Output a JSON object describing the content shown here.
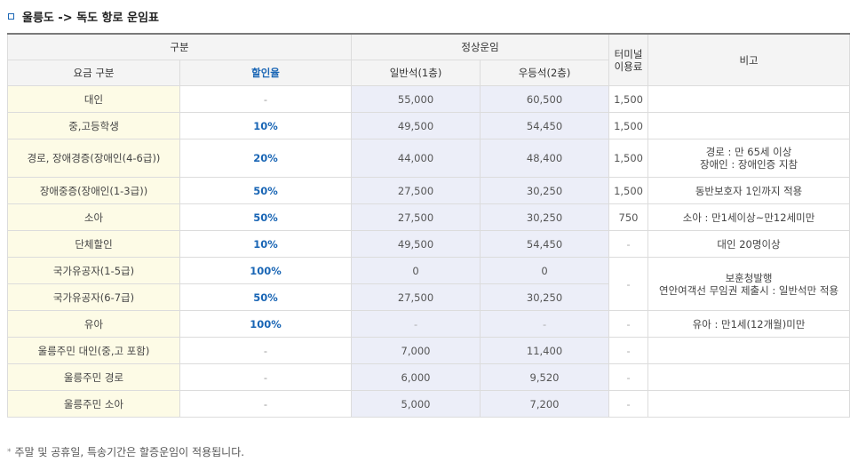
{
  "title": "울릉도 -> 독도 항로 운임표",
  "headers": {
    "category_group": "구분",
    "regular_fare": "정상운임",
    "terminal_fee": "터미널\n이용료",
    "remarks": "비고",
    "fare_type": "요금 구분",
    "discount_rate": "할인율",
    "general_seat": "일반석(1층)",
    "premium_seat": "우등석(2층)"
  },
  "rows": [
    {
      "category": "대인",
      "rate": "-",
      "general": "55,000",
      "premium": "60,500",
      "terminal": "1,500",
      "remark": ""
    },
    {
      "category": "중,고등학생",
      "rate": "10%",
      "general": "49,500",
      "premium": "54,450",
      "terminal": "1,500",
      "remark": ""
    },
    {
      "category": "경로, 장애경증(장애인(4-6급))",
      "rate": "20%",
      "general": "44,000",
      "premium": "48,400",
      "terminal": "1,500",
      "remark": "경로 : 만 65세 이상\n장애인 : 장애인증 지참"
    },
    {
      "category": "장애중증(장애인(1-3급))",
      "rate": "50%",
      "general": "27,500",
      "premium": "30,250",
      "terminal": "1,500",
      "remark": "동반보호자 1인까지 적용"
    },
    {
      "category": "소아",
      "rate": "50%",
      "general": "27,500",
      "premium": "30,250",
      "terminal": "750",
      "remark": "소아 : 만1세이상~만12세미만"
    },
    {
      "category": "단체할인",
      "rate": "10%",
      "general": "49,500",
      "premium": "54,450",
      "terminal": "-",
      "remark": "대인 20명이상"
    },
    {
      "category": "국가유공자(1-5급)",
      "rate": "100%",
      "general": "0",
      "premium": "0",
      "terminal": "-",
      "remark": "보훈청발행\n연안여객선 무임권 제출시 : 일반석만 적용"
    },
    {
      "category": "국가유공자(6-7급)",
      "rate": "50%",
      "general": "27,500",
      "premium": "30,250"
    },
    {
      "category": "유아",
      "rate": "100%",
      "general": "-",
      "premium": "-",
      "terminal": "-",
      "remark": "유아 : 만1세(12개월)미만"
    },
    {
      "category": "울릉주민 대인(중,고 포함)",
      "rate": "-",
      "general": "7,000",
      "premium": "11,400",
      "terminal": "-",
      "remark": ""
    },
    {
      "category": "울릉주민 경로",
      "rate": "-",
      "general": "6,000",
      "premium": "9,520",
      "terminal": "-",
      "remark": ""
    },
    {
      "category": "울릉주민 소아",
      "rate": "-",
      "general": "5,000",
      "premium": "7,200",
      "terminal": "-",
      "remark": ""
    }
  ],
  "footnote": "주말 및 공휴일, 특송기간은 할증운임이 적용됩니다.",
  "colors": {
    "accent": "#1a66b5",
    "category_bg": "#fdfbe6",
    "fare_bg": "#eceef8",
    "header_bg": "#f4f4f4"
  }
}
